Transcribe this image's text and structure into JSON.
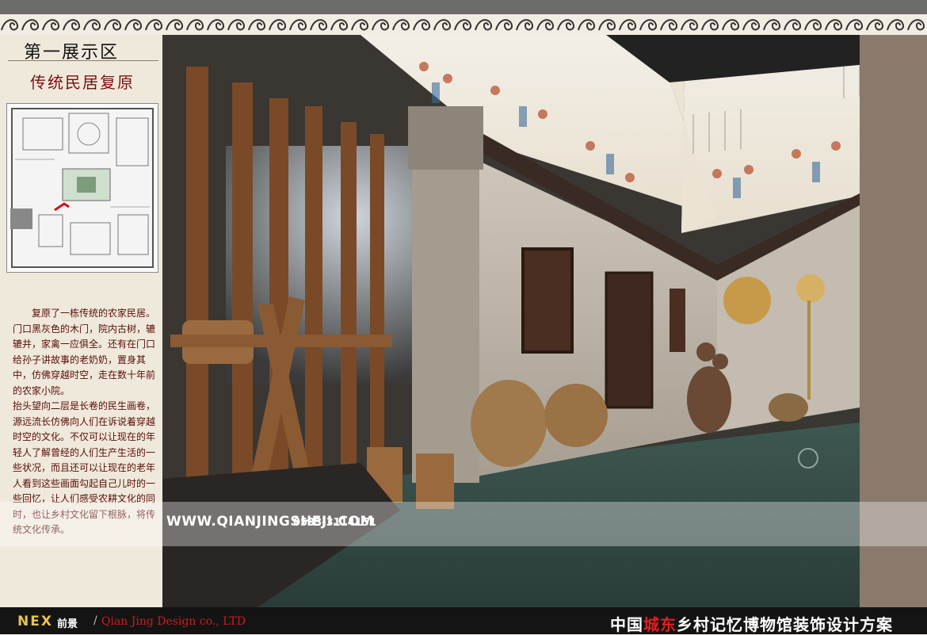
{
  "header": {
    "zone_title": "第一展示区",
    "zone_subtitle": "传统民居复原"
  },
  "description": {
    "paragraphs": [
      "复原了一栋传统的农家民居。门口黑灰色的木门，院内古树，辘辘井，家禽一应俱全。还有在门口给孙子讲故事的老奶奶，置身其中，仿佛穿越时空，走在数十年前的农家小院。",
      "抬头望向二层是长卷的民生画卷，源远流长仿佛向人们在诉说着穿越时空的文化。不仅可以让现在的年轻人了解曾经的人们生产生活的一些状况，而且还可以让现在的老年人看到这些画面勾起自己儿时的一些回忆，让人们感受农耕文化的同时，也让乡村文化留下根脉，将传统文化传承。"
    ]
  },
  "watermark": {
    "site": "WWW.QIANJINGSHEJI.COM",
    "phone": "0533-3114151"
  },
  "footer": {
    "logo": "NEX",
    "logo_cn": "前景",
    "company": "Qian Jing Design co., LTD",
    "project_prefix": "中国",
    "project_highlight": "城东",
    "project_suffix": "乡村记忆博物馆装饰设计方案"
  },
  "colors": {
    "accent_red": "#7a1010",
    "highlight_red": "#e02020",
    "logo_gold": "#e8c34a"
  }
}
